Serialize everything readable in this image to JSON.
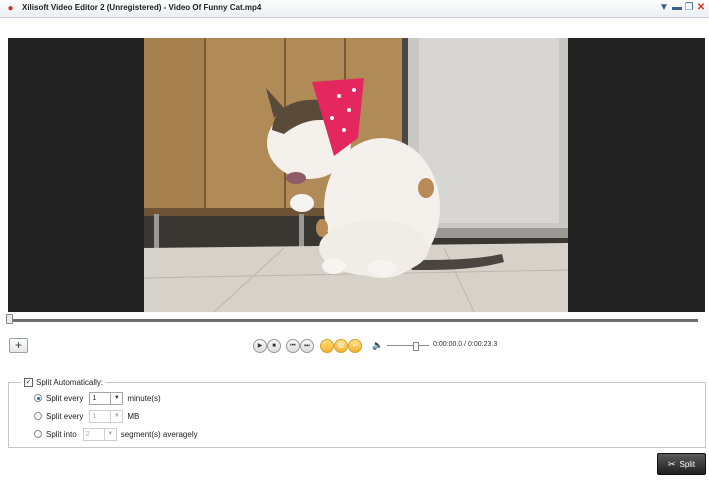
{
  "window": {
    "title": "Xilisoft Video Editor 2 (Unregistered) - Video Of Funny Cat.mp4",
    "app_icon": "●",
    "controls": {
      "menu": "▼",
      "minimize": "▬",
      "restore": "❐",
      "close": "✕"
    }
  },
  "player": {
    "add_label": "+",
    "controls": {
      "play": "▶",
      "stop": "■",
      "prev_frame": "⏮",
      "next_frame": "⏭",
      "split_marker": "⚡",
      "delete": "▥",
      "undo": "↩"
    },
    "volume_icon": "🔈",
    "timecode": "0:00:00.0 / 0:00:23.3",
    "progress_fraction": 0.0,
    "volume_fraction": 0.62
  },
  "split_panel": {
    "auto_label": "Split Automatically:",
    "auto_checked": "✓",
    "options": [
      {
        "label": "Split every",
        "value": "1",
        "unit": "minute(s)",
        "selected": true,
        "enabled": true
      },
      {
        "label": "Split every",
        "value": "1",
        "unit": "MB",
        "selected": false,
        "enabled": false
      },
      {
        "label": "Split into",
        "value": "2",
        "unit": "segment(s) averagely",
        "selected": false,
        "enabled": false
      }
    ],
    "dropdown_arrow": "▼"
  },
  "split_button": {
    "label": "Split",
    "icon": "✂"
  },
  "colors": {
    "stage_bg": "#232323",
    "accent": "#f2b233",
    "title_close": "#e0301e"
  }
}
